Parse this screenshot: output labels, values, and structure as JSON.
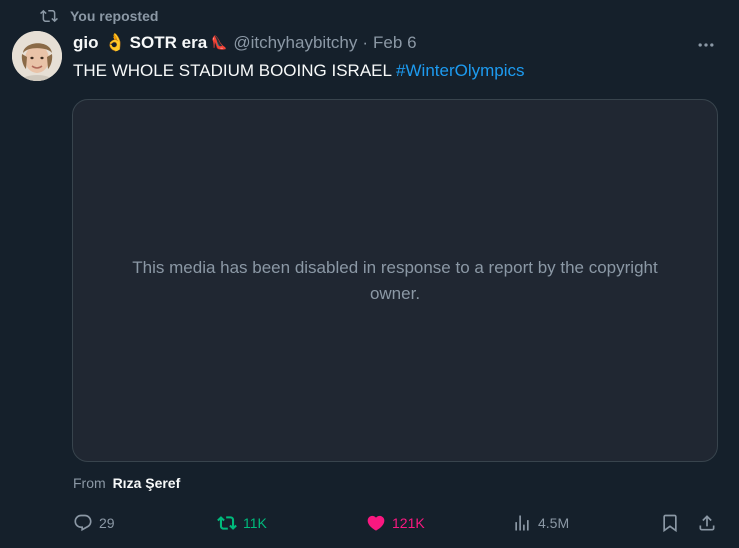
{
  "repost_banner": {
    "label": "You reposted",
    "icon": "repost-icon"
  },
  "author": {
    "display_name": "gio",
    "hand_emoji": "👌",
    "name_suffix": "SOTR era",
    "shoe_emoji": "👠",
    "handle": "@itchyhaybitchy",
    "separator": "·",
    "date": "Feb 6"
  },
  "tweet": {
    "text": "THE WHOLE STADIUM BOOING ISRAEL ",
    "hashtag": "#WinterOlympics"
  },
  "media": {
    "message": "This media has been disabled in response to a report by the copyright owner."
  },
  "source": {
    "prefix": "From",
    "name": "Rıza Şeref"
  },
  "actions": {
    "replies": "29",
    "reposts": "11K",
    "likes": "121K",
    "views": "4.5M"
  },
  "colors": {
    "background": "#15202b",
    "muted": "#8b98a5",
    "link": "#1d9bf0",
    "repost_active": "#00ba7c",
    "like_active": "#f91880"
  }
}
